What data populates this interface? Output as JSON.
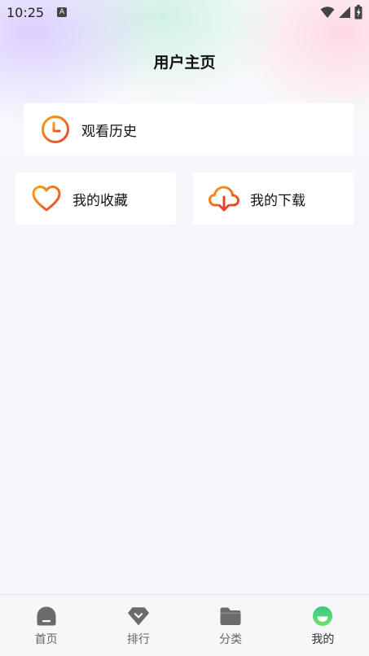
{
  "status_bar": {
    "time": "10:25",
    "notification_letter": "A"
  },
  "header": {
    "title": "用户主页"
  },
  "cards": {
    "history": {
      "label": "观看历史",
      "icon": "clock-icon"
    },
    "favorites": {
      "label": "我的收藏",
      "icon": "heart-icon"
    },
    "downloads": {
      "label": "我的下载",
      "icon": "cloud-download-icon"
    }
  },
  "bottom_nav": {
    "items": [
      {
        "label": "首页",
        "icon": "home-icon",
        "active": false
      },
      {
        "label": "排行",
        "icon": "ranking-icon",
        "active": false
      },
      {
        "label": "分类",
        "icon": "folder-icon",
        "active": false
      },
      {
        "label": "我的",
        "icon": "profile-smile-icon",
        "active": true
      }
    ]
  },
  "colors": {
    "icon_gradient_start": "#f7a11a",
    "icon_gradient_end": "#e8432a",
    "nav_icon_inactive": "#6b6b6b",
    "nav_icon_active": "#3ecf7a"
  }
}
